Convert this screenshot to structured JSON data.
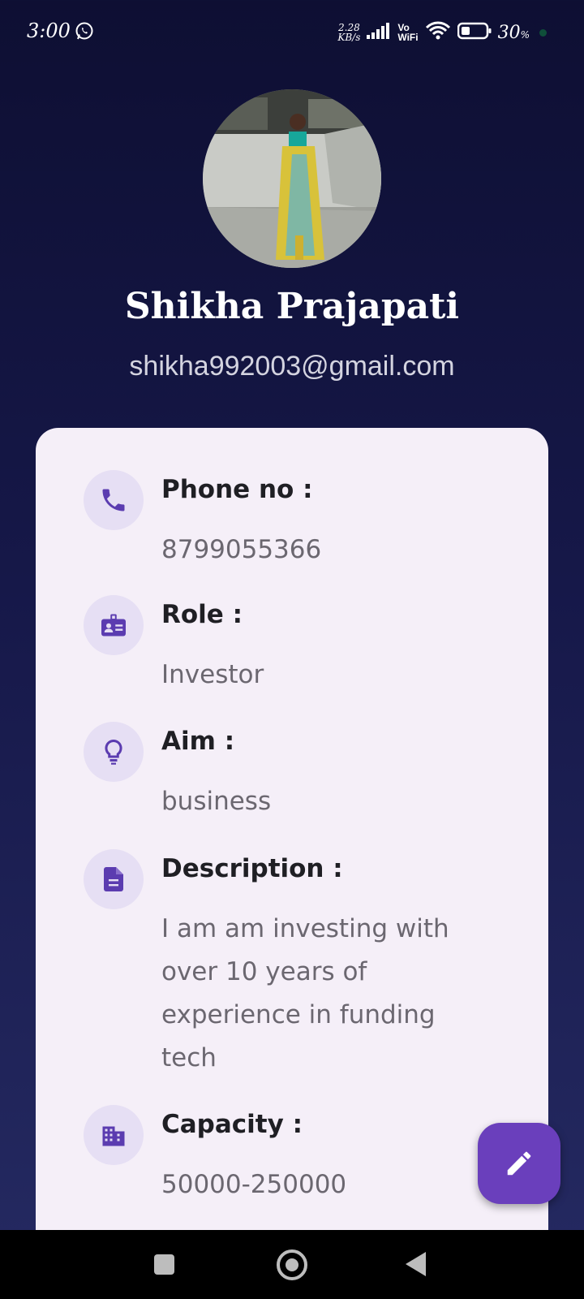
{
  "status_bar": {
    "time": "3:00",
    "net_speed_value": "2.28",
    "net_speed_unit": "KB/s",
    "vo_label": "Vo",
    "wifi_label": "WiFi",
    "battery_percent": "30",
    "battery_percent_sign": "%"
  },
  "profile": {
    "name": "Shikha Prajapati",
    "email": "shikha992003@gmail.com"
  },
  "details": [
    {
      "label": "Phone no :",
      "value": "8799055366",
      "icon": "phone-icon"
    },
    {
      "label": "Role :",
      "value": "Investor",
      "icon": "badge-icon"
    },
    {
      "label": "Aim :",
      "value": "business",
      "icon": "lightbulb-icon"
    },
    {
      "label": "Description :",
      "value": "I am am investing with over 10 years of experience in funding tech",
      "icon": "document-icon"
    },
    {
      "label": "Capacity :",
      "value": "50000-250000",
      "icon": "building-icon"
    }
  ],
  "fab": {
    "icon": "edit-pencil-icon"
  },
  "colors": {
    "accent": "#6a3fbc",
    "card_background": "#f5eff8",
    "icon_circle": "#e6dff4",
    "icon_color": "#5b3cb0",
    "background_top": "#0e0f33",
    "background_bottom": "#252a62"
  }
}
